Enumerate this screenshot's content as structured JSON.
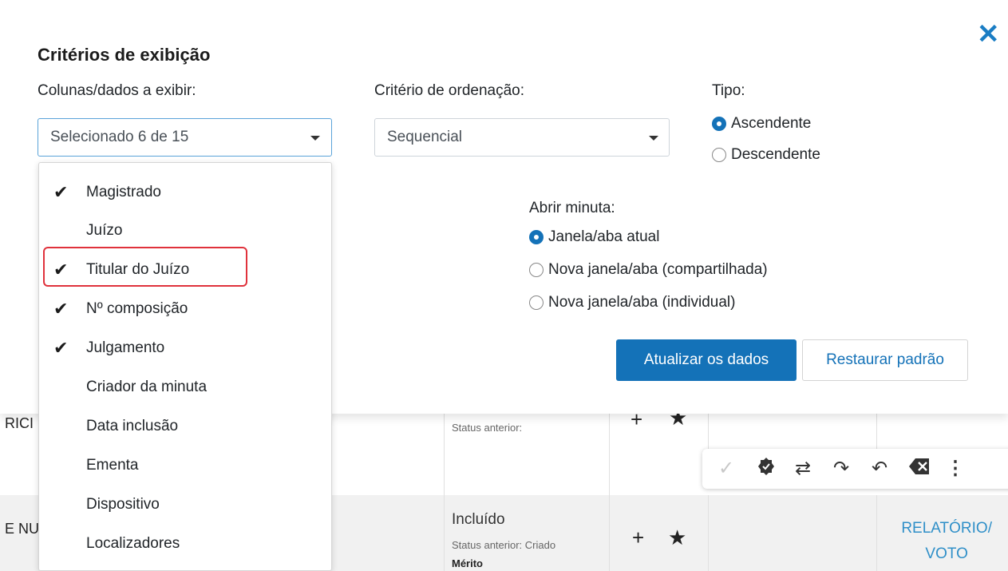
{
  "panel": {
    "title": "Critérios de exibição",
    "close_icon": "close-icon",
    "columns": {
      "label": "Colunas/dados a exibir:",
      "selected": "Selecionado 6 de 15"
    },
    "sort": {
      "label": "Critério de ordenação:",
      "selected": "Sequencial"
    },
    "type": {
      "label": "Tipo:",
      "options": [
        {
          "label": "Ascendente",
          "checked": true
        },
        {
          "label": "Descendente",
          "checked": false
        }
      ]
    },
    "open_draft": {
      "label": "Abrir minuta:",
      "options": [
        {
          "label": "Janela/aba atual",
          "checked": true
        },
        {
          "label": "Nova janela/aba (compartilhada)",
          "checked": false
        },
        {
          "label": "Nova janela/aba (individual)",
          "checked": false
        }
      ]
    },
    "buttons": {
      "update": "Atualizar os dados",
      "restore": "Restaurar padrão"
    }
  },
  "dropdown": {
    "items": [
      {
        "label": "Magistrado",
        "checked": true
      },
      {
        "label": "Juízo",
        "checked": false
      },
      {
        "label": "Titular do Juízo",
        "checked": true
      },
      {
        "label": "Nº composição",
        "checked": true
      },
      {
        "label": "Julgamento",
        "checked": true
      },
      {
        "label": "Criador da minuta",
        "checked": false
      },
      {
        "label": "Data inclusão",
        "checked": false
      },
      {
        "label": "Ementa",
        "checked": false
      },
      {
        "label": "Dispositivo",
        "checked": false
      },
      {
        "label": "Localizadores",
        "checked": false
      }
    ],
    "check_glyph": "✔"
  },
  "background": {
    "row1": {
      "left_text": "RICI",
      "status_small": "Status anterior:"
    },
    "toolbar_icons": [
      "check-icon",
      "verified-badge-icon",
      "swap-icon",
      "redo-icon",
      "undo-icon",
      "backspace-icon",
      "more-vertical-icon"
    ],
    "row3": {
      "left_text": "E NU",
      "status": "Incluído",
      "status_prev": "Status anterior: Criado",
      "status_bold": "Mérito",
      "link_line1": "RELATÓRIO/",
      "link_line2": "VOTO"
    }
  },
  "colors": {
    "primary": "#1472b8",
    "highlight": "#e0323c",
    "link": "#2f8fc8"
  }
}
